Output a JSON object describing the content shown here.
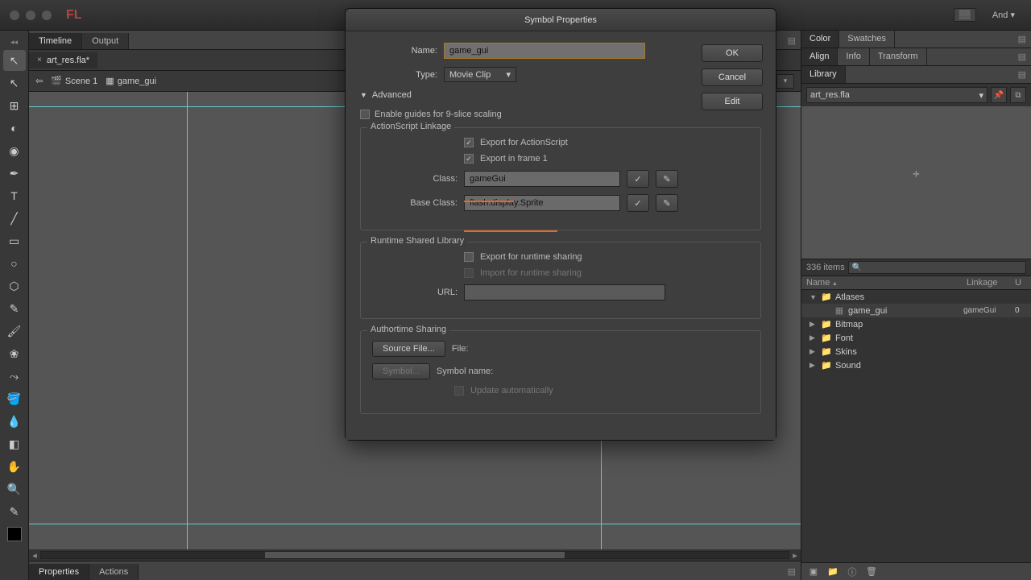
{
  "mac": {
    "menu": "And"
  },
  "top_tabs": {
    "timeline": "Timeline",
    "output": "Output"
  },
  "doc_tab": {
    "label": "art_res.fla*"
  },
  "breadcrumb": {
    "scene": "Scene 1",
    "symbol": "game_gui"
  },
  "bottom_tabs": {
    "properties": "Properties",
    "actions": "Actions"
  },
  "panels": {
    "color": "Color",
    "swatches": "Swatches",
    "align": "Align",
    "info": "Info",
    "transform": "Transform",
    "library": "Library"
  },
  "library": {
    "file": "art_res.fla",
    "items_count": "336 items",
    "cols": {
      "name": "Name",
      "linkage": "Linkage",
      "use": "U"
    },
    "tree": [
      {
        "depth": 0,
        "kind": "folder",
        "open": true,
        "label": "Atlases"
      },
      {
        "depth": 1,
        "kind": "clip",
        "open": false,
        "label": "game_gui",
        "linkage": "gameGui",
        "use": "0",
        "selected": true
      },
      {
        "depth": 0,
        "kind": "folder",
        "open": false,
        "label": "Bitmap"
      },
      {
        "depth": 0,
        "kind": "folder",
        "open": false,
        "label": "Font"
      },
      {
        "depth": 0,
        "kind": "folder",
        "open": false,
        "label": "Skins"
      },
      {
        "depth": 0,
        "kind": "folder",
        "open": false,
        "label": "Sound"
      }
    ]
  },
  "dialog": {
    "title": "Symbol Properties",
    "name_label": "Name:",
    "name_value": "game_gui",
    "type_label": "Type:",
    "type_value": "Movie Clip",
    "btn_ok": "OK",
    "btn_cancel": "Cancel",
    "btn_edit": "Edit",
    "advanced": "Advanced",
    "nine_slice": "Enable guides for 9-slice scaling",
    "as": {
      "title": "ActionScript Linkage",
      "export_as": "Export for ActionScript",
      "export_f1": "Export in frame 1",
      "class_label": "Class:",
      "class_value": "gameGui",
      "base_label": "Base Class:",
      "base_value": "flash.display.Sprite"
    },
    "rsl": {
      "title": "Runtime Shared Library",
      "export": "Export for runtime sharing",
      "import": "Import for runtime sharing",
      "url_label": "URL:"
    },
    "auth": {
      "title": "Authortime Sharing",
      "source_btn": "Source File...",
      "file_label": "File:",
      "symbol_btn": "Symbol...",
      "symname_label": "Symbol name:",
      "update": "Update automatically"
    }
  }
}
